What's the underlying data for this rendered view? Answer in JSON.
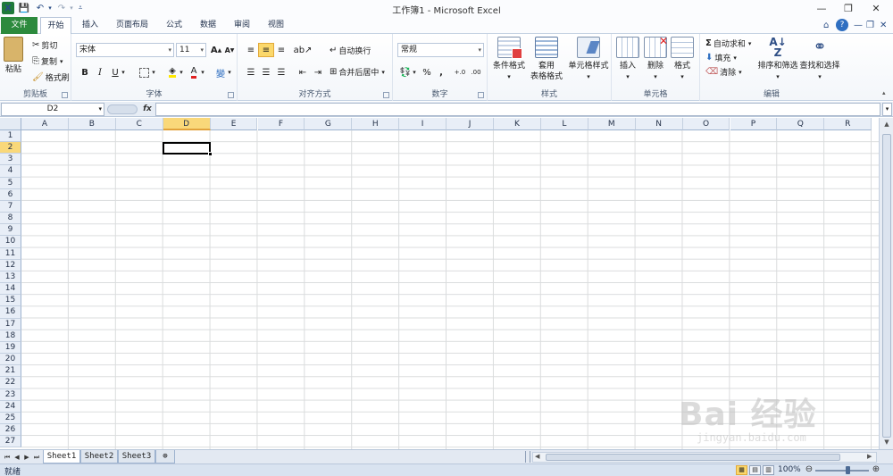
{
  "window": {
    "title": "工作簿1 - Microsoft Excel",
    "app_icon": "X"
  },
  "tabs": {
    "file": "文件",
    "home": "开始",
    "insert": "插入",
    "layout": "页面布局",
    "formulas": "公式",
    "data": "数据",
    "review": "审阅",
    "view": "视图"
  },
  "clipboard": {
    "paste": "粘贴",
    "cut": "剪切",
    "copy": "复制",
    "format_painter": "格式刷",
    "label": "剪贴板"
  },
  "font": {
    "name": "宋体",
    "size": "11",
    "bold": "B",
    "italic": "I",
    "underline": "U",
    "font_color_glyph": "A",
    "phonetic_glyph": "變",
    "label": "字体"
  },
  "alignment": {
    "wrap_text": "自动换行",
    "merge_center": "合并后居中",
    "label": "对齐方式"
  },
  "number": {
    "format": "常规",
    "percent": "%",
    "comma": ",",
    "label": "数字"
  },
  "styles": {
    "conditional": "条件格式",
    "table_line1": "套用",
    "table_line2": "表格格式",
    "cell_styles": "单元格样式",
    "label": "样式"
  },
  "cells": {
    "insert": "插入",
    "delete": "删除",
    "format": "格式",
    "label": "单元格"
  },
  "editing": {
    "autosum": "自动求和",
    "fill": "填充",
    "clear": "清除",
    "sort_filter": "排序和筛选",
    "find_select": "查找和选择",
    "label": "编辑"
  },
  "formula_bar": {
    "name_box": "D2",
    "fx": "fx",
    "value": ""
  },
  "grid": {
    "columns": [
      "A",
      "B",
      "C",
      "D",
      "E",
      "F",
      "G",
      "H",
      "I",
      "J",
      "K",
      "L",
      "M",
      "N",
      "O",
      "P",
      "Q",
      "R"
    ],
    "rows": [
      "1",
      "2",
      "3",
      "4",
      "5",
      "6",
      "7",
      "8",
      "9",
      "10",
      "11",
      "12",
      "13",
      "14",
      "15",
      "16",
      "17",
      "18",
      "19",
      "20",
      "21",
      "22",
      "23",
      "24",
      "25",
      "26",
      "27"
    ],
    "active_column": "D",
    "active_row": "2"
  },
  "sheets": [
    "Sheet1",
    "Sheet2",
    "Sheet3"
  ],
  "status": {
    "ready": "就绪",
    "zoom": "100%"
  },
  "watermark": {
    "main": "Bai 经验",
    "sub": "jingyan.baidu.com"
  },
  "colors": {
    "file_tab": "#2c8a3d",
    "selection": "#fbd86b",
    "header_bg": "#e8eef7"
  }
}
